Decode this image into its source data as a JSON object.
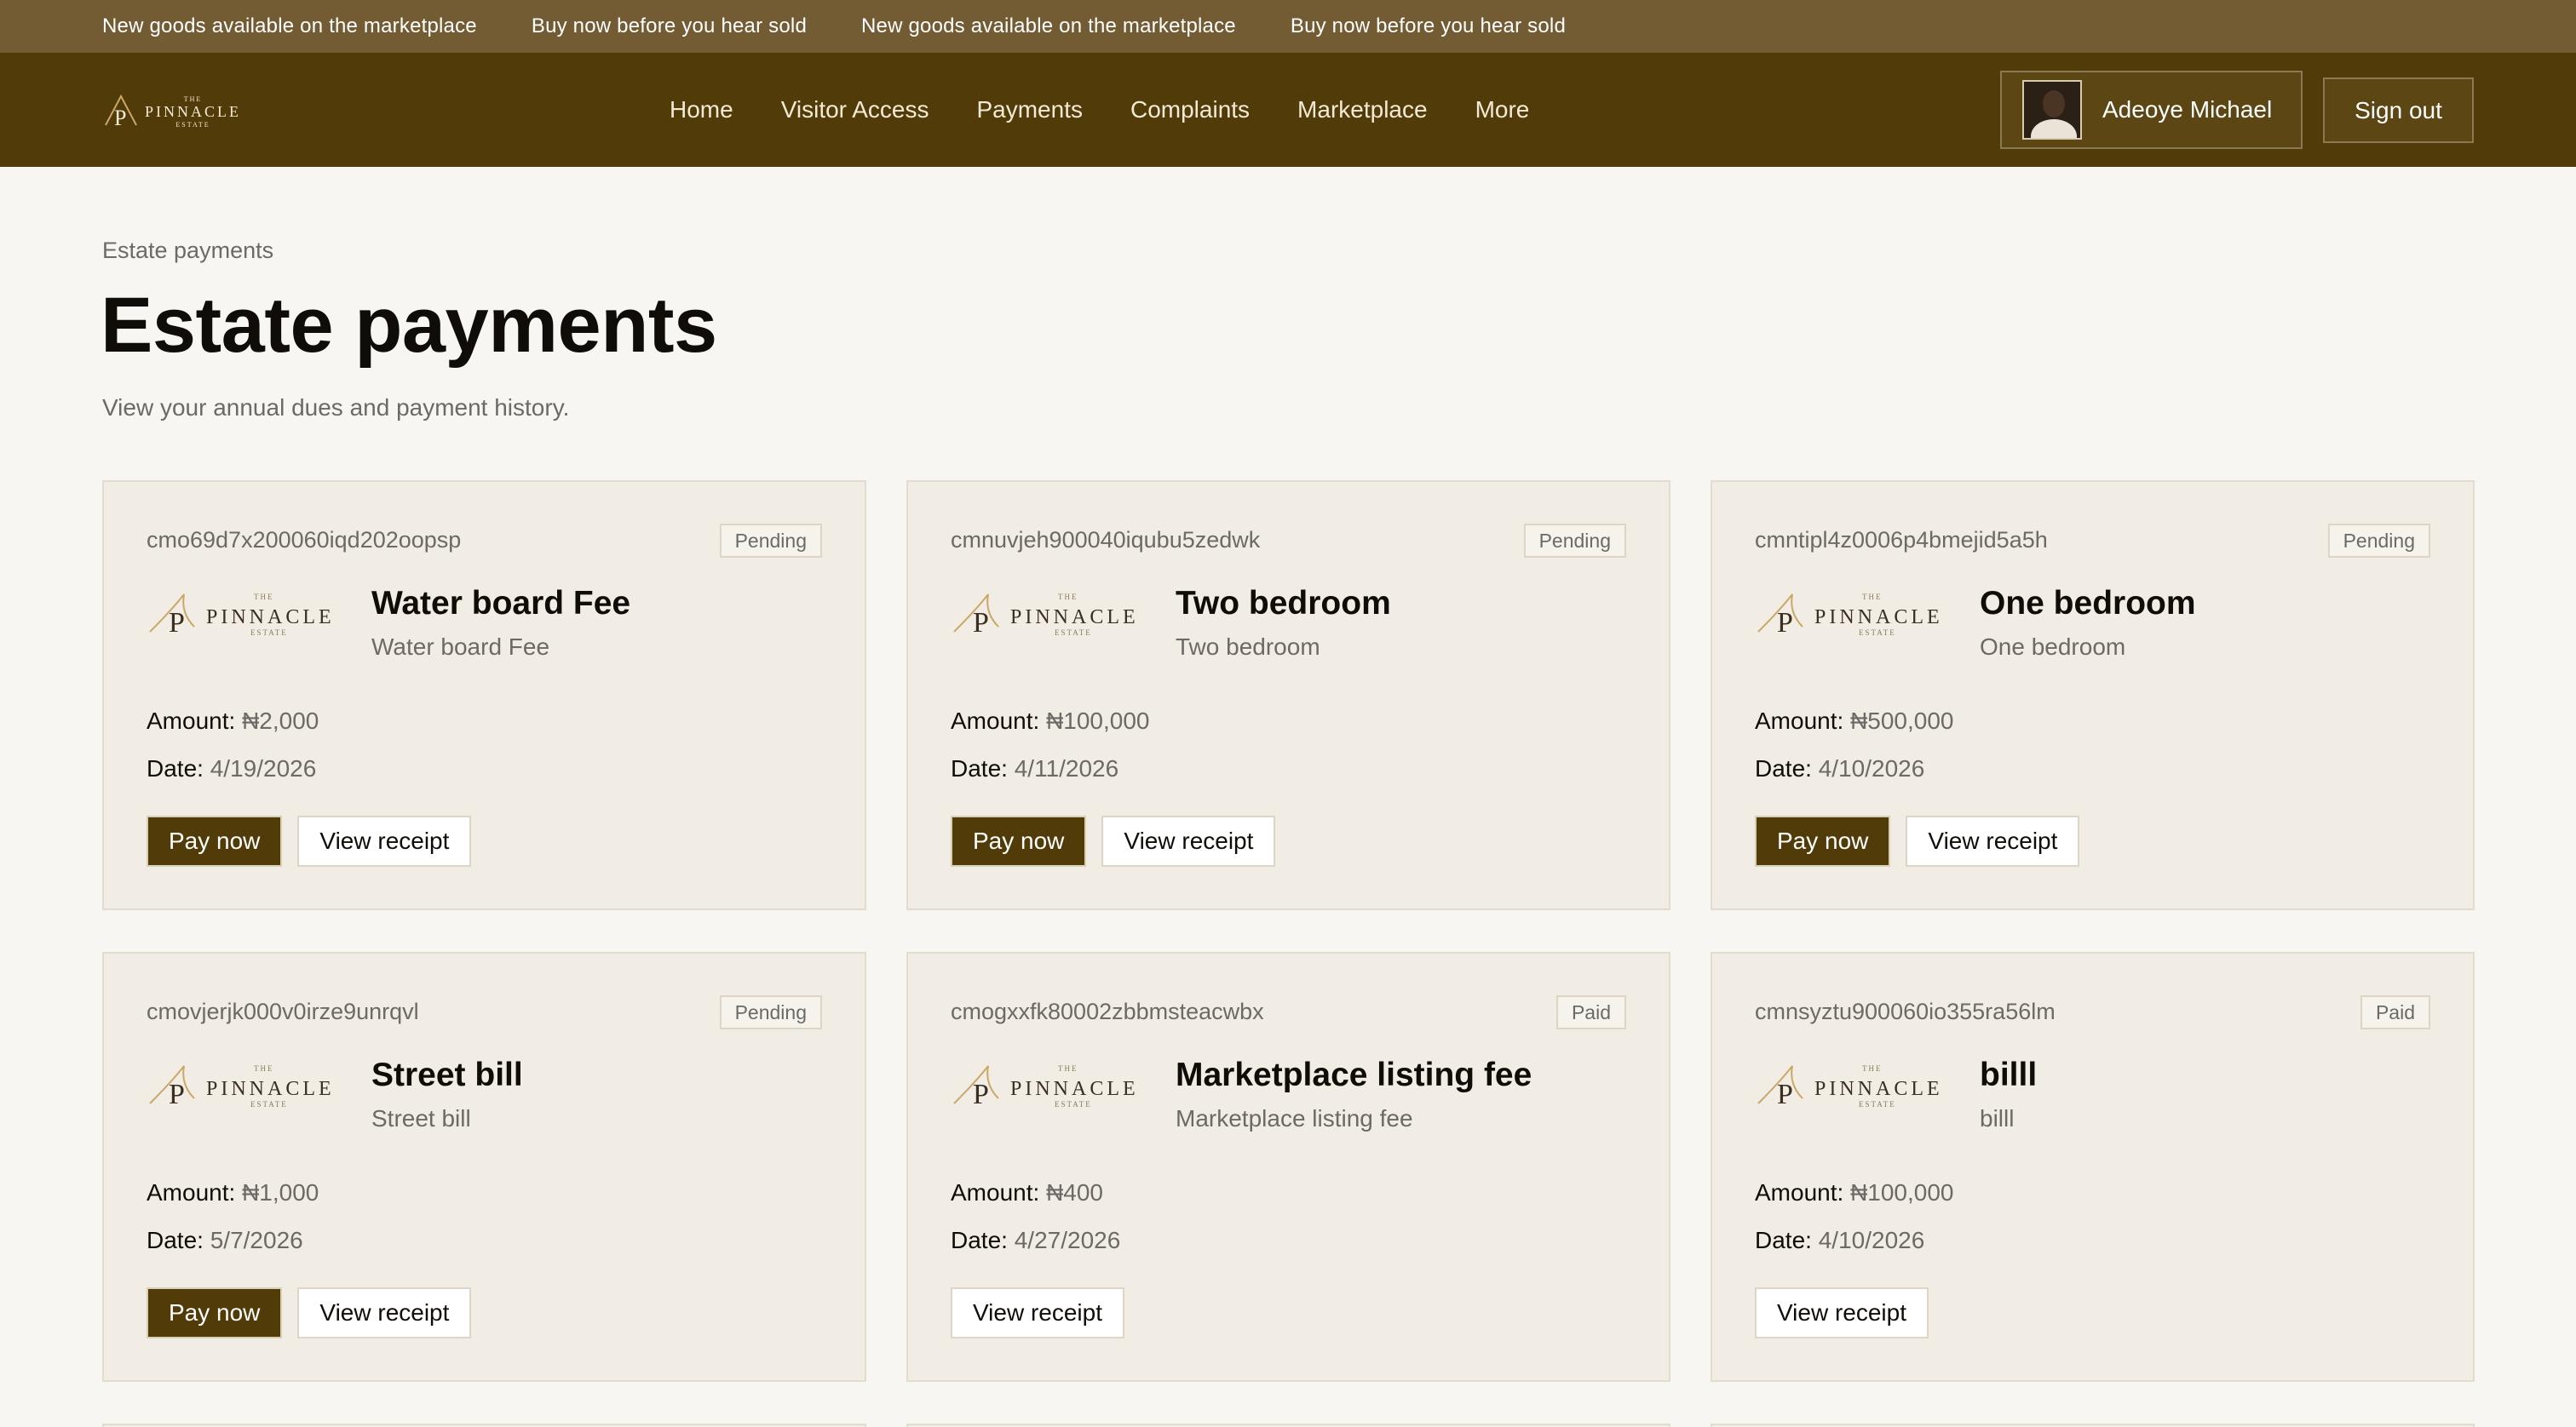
{
  "ticker": {
    "items": [
      "New goods available on the marketplace",
      "Buy now before you hear sold",
      "New goods available on the marketplace",
      "Buy now before you hear sold"
    ]
  },
  "header": {
    "logo": {
      "wordmark": "PINNACLE",
      "top_word": "THE",
      "bottom_word": "ESTATE"
    },
    "nav": [
      "Home",
      "Visitor Access",
      "Payments",
      "Complaints",
      "Marketplace",
      "More"
    ],
    "user": {
      "name": "Adeoye Michael"
    },
    "signout_label": "Sign out"
  },
  "page": {
    "breadcrumb": "Estate payments",
    "title": "Estate payments",
    "subtitle": "View your annual dues and payment history."
  },
  "labels": {
    "amount": "Amount:",
    "date": "Date:",
    "pay_now": "Pay now",
    "view_receipt": "View receipt"
  },
  "payments": [
    {
      "id": "cmo69d7x200060iqd202oopsp",
      "status": "Pending",
      "title": "Water board Fee",
      "subtitle": "Water board Fee",
      "amount": "₦2,000",
      "date": "4/19/2026",
      "can_pay": true
    },
    {
      "id": "cmnuvjeh900040iqubu5zedwk",
      "status": "Pending",
      "title": "Two bedroom",
      "subtitle": "Two bedroom",
      "amount": "₦100,000",
      "date": "4/11/2026",
      "can_pay": true
    },
    {
      "id": "cmntipl4z0006p4bmejid5a5h",
      "status": "Pending",
      "title": "One bedroom",
      "subtitle": "One bedroom",
      "amount": "₦500,000",
      "date": "4/10/2026",
      "can_pay": true
    },
    {
      "id": "cmovjerjk000v0irze9unrqvl",
      "status": "Pending",
      "title": "Street bill",
      "subtitle": "Street bill",
      "amount": "₦1,000",
      "date": "5/7/2026",
      "can_pay": true
    },
    {
      "id": "cmogxxfk80002zbbmsteacwbx",
      "status": "Paid",
      "title": "Marketplace listing fee",
      "subtitle": "Marketplace listing fee",
      "amount": "₦400",
      "date": "4/27/2026",
      "can_pay": false
    },
    {
      "id": "cmnsyztu900060io355ra56lm",
      "status": "Paid",
      "title": "billl",
      "subtitle": "billl",
      "amount": "₦100,000",
      "date": "4/10/2026",
      "can_pay": false
    }
  ],
  "colors": {
    "ticker_bg": "#735c34",
    "header_bg": "#513b08",
    "accent": "#513b08",
    "page_bg": "#f7f6f2",
    "card_bg": "#f1ede4"
  }
}
